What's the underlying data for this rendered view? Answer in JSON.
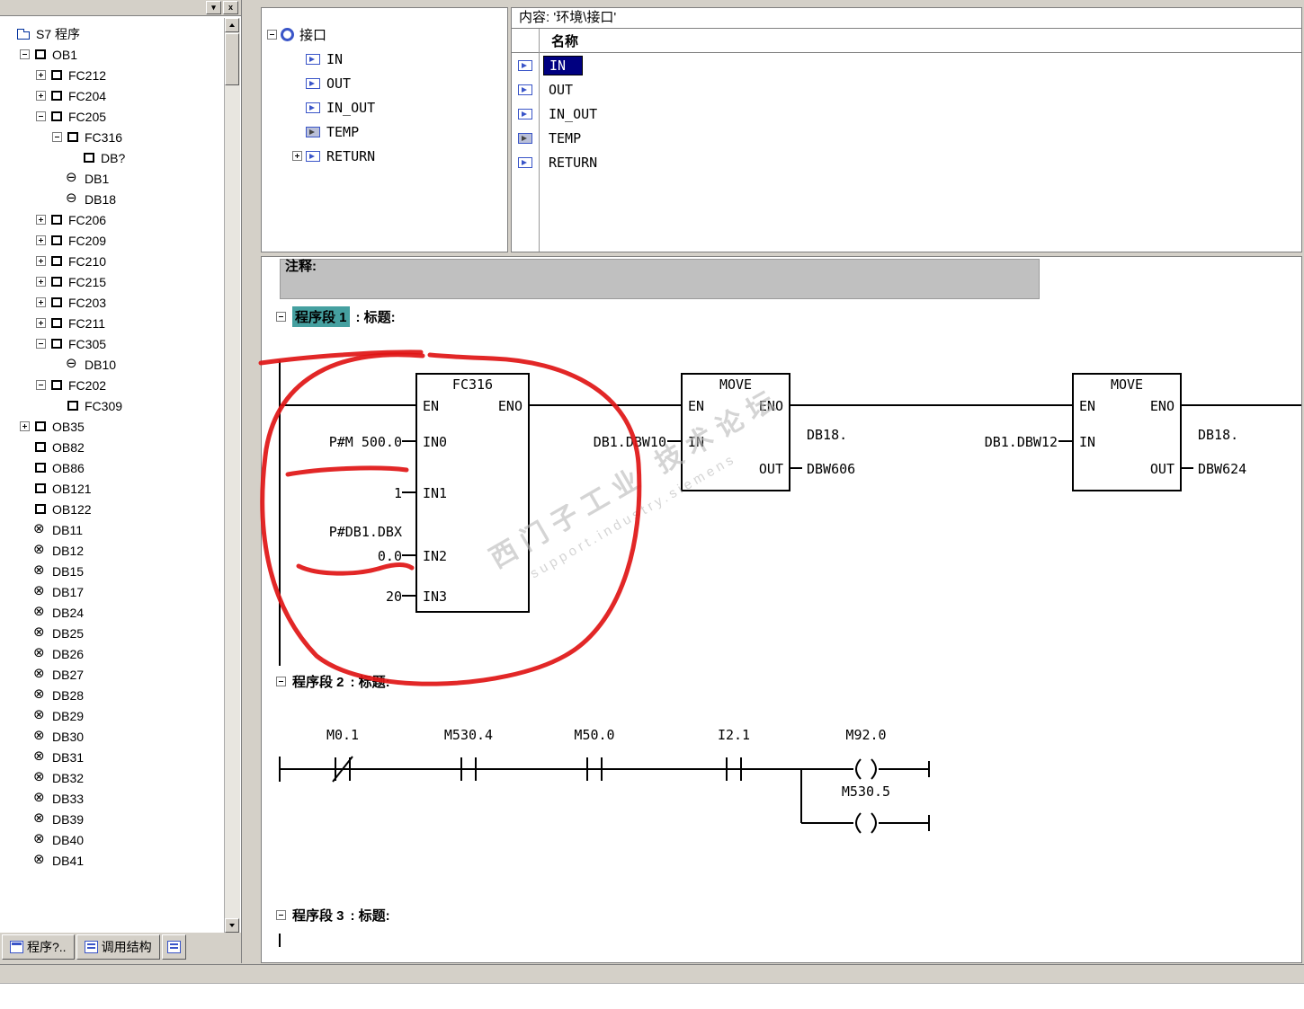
{
  "colors": {
    "chrome": "#d4d0c8",
    "border": "#808080",
    "commentGray": "#c0c0c0",
    "selectionNavy": "#000080",
    "networkTeal": "#45a0a0",
    "iconBlue": "#3a55c8",
    "watermarkGray": "#b9b9b9"
  },
  "left_panel": {
    "pin_glyph": "▾",
    "close_glyph": "x",
    "tabs": [
      {
        "label": "程序?.."
      },
      {
        "label": "调用结构"
      },
      {
        "label": ""
      }
    ],
    "tree": {
      "items": [
        {
          "label": "S7 程序",
          "levelClass": "lvl0",
          "expClass": "noexp",
          "iconClass": "icon-folder"
        },
        {
          "label": "OB1",
          "levelClass": "lvl1",
          "expClass": "minus",
          "iconClass": "icon-block"
        },
        {
          "label": "FC212",
          "levelClass": "lvl2",
          "expClass": "plus",
          "iconClass": "icon-block"
        },
        {
          "label": "FC204",
          "levelClass": "lvl2",
          "expClass": "plus",
          "iconClass": "icon-block"
        },
        {
          "label": "FC205",
          "levelClass": "lvl2",
          "expClass": "minus",
          "iconClass": "icon-block"
        },
        {
          "label": "FC316",
          "levelClass": "lvl3",
          "expClass": "minus",
          "iconClass": "icon-block"
        },
        {
          "label": "DB?",
          "levelClass": "lvl4",
          "expClass": "noexp",
          "iconClass": "icon-block"
        },
        {
          "label": "DB1",
          "levelClass": "lvl3",
          "expClass": "noexp",
          "iconClass": "icon-db"
        },
        {
          "label": "DB18",
          "levelClass": "lvl3",
          "expClass": "noexp",
          "iconClass": "icon-db"
        },
        {
          "label": "FC206",
          "levelClass": "lvl2",
          "expClass": "plus",
          "iconClass": "icon-block"
        },
        {
          "label": "FC209",
          "levelClass": "lvl2",
          "expClass": "plus",
          "iconClass": "icon-block"
        },
        {
          "label": "FC210",
          "levelClass": "lvl2",
          "expClass": "plus",
          "iconClass": "icon-block"
        },
        {
          "label": "FC215",
          "levelClass": "lvl2",
          "expClass": "plus",
          "iconClass": "icon-block"
        },
        {
          "label": "FC203",
          "levelClass": "lvl2",
          "expClass": "plus",
          "iconClass": "icon-block"
        },
        {
          "label": "FC211",
          "levelClass": "lvl2",
          "expClass": "plus",
          "iconClass": "icon-block"
        },
        {
          "label": "FC305",
          "levelClass": "lvl2",
          "expClass": "minus",
          "iconClass": "icon-block"
        },
        {
          "label": "DB10",
          "levelClass": "lvl3",
          "expClass": "noexp",
          "iconClass": "icon-db"
        },
        {
          "label": "FC202",
          "levelClass": "lvl2",
          "expClass": "minus",
          "iconClass": "icon-block"
        },
        {
          "label": "FC309",
          "levelClass": "lvl3",
          "expClass": "noexp",
          "iconClass": "icon-block"
        },
        {
          "label": "OB35",
          "levelClass": "lvl1",
          "expClass": "plus",
          "iconClass": "icon-block"
        },
        {
          "label": "OB82",
          "levelClass": "lvl1",
          "expClass": "noexp",
          "iconClass": "icon-block"
        },
        {
          "label": "OB86",
          "levelClass": "lvl1",
          "expClass": "noexp",
          "iconClass": "icon-block"
        },
        {
          "label": "OB121",
          "levelClass": "lvl1",
          "expClass": "noexp",
          "iconClass": "icon-block"
        },
        {
          "label": "OB122",
          "levelClass": "lvl1",
          "expClass": "noexp",
          "iconClass": "icon-block"
        },
        {
          "label": "DB11",
          "levelClass": "lvl1",
          "expClass": "noexp",
          "iconClass": "icon-dbx"
        },
        {
          "label": "DB12",
          "levelClass": "lvl1",
          "expClass": "noexp",
          "iconClass": "icon-dbx"
        },
        {
          "label": "DB15",
          "levelClass": "lvl1",
          "expClass": "noexp",
          "iconClass": "icon-dbx"
        },
        {
          "label": "DB17",
          "levelClass": "lvl1",
          "expClass": "noexp",
          "iconClass": "icon-dbx"
        },
        {
          "label": "DB24",
          "levelClass": "lvl1",
          "expClass": "noexp",
          "iconClass": "icon-dbx"
        },
        {
          "label": "DB25",
          "levelClass": "lvl1",
          "expClass": "noexp",
          "iconClass": "icon-dbx"
        },
        {
          "label": "DB26",
          "levelClass": "lvl1",
          "expClass": "noexp",
          "iconClass": "icon-dbx"
        },
        {
          "label": "DB27",
          "levelClass": "lvl1",
          "expClass": "noexp",
          "iconClass": "icon-dbx"
        },
        {
          "label": "DB28",
          "levelClass": "lvl1",
          "expClass": "noexp",
          "iconClass": "icon-dbx"
        },
        {
          "label": "DB29",
          "levelClass": "lvl1",
          "expClass": "noexp",
          "iconClass": "icon-dbx"
        },
        {
          "label": "DB30",
          "levelClass": "lvl1",
          "expClass": "noexp",
          "iconClass": "icon-dbx"
        },
        {
          "label": "DB31",
          "levelClass": "lvl1",
          "expClass": "noexp",
          "iconClass": "icon-dbx"
        },
        {
          "label": "DB32",
          "levelClass": "lvl1",
          "expClass": "noexp",
          "iconClass": "icon-dbx"
        },
        {
          "label": "DB33",
          "levelClass": "lvl1",
          "expClass": "noexp",
          "iconClass": "icon-dbx"
        },
        {
          "label": "DB39",
          "levelClass": "lvl1",
          "expClass": "noexp",
          "iconClass": "icon-dbx"
        },
        {
          "label": "DB40",
          "levelClass": "lvl1",
          "expClass": "noexp",
          "iconClass": "icon-dbx"
        },
        {
          "label": "DB41",
          "levelClass": "lvl1",
          "expClass": "noexp",
          "iconClass": "icon-dbx"
        }
      ]
    }
  },
  "interface_panel": {
    "root_label": "接口",
    "items": [
      {
        "label": "IN",
        "iconClass": "ic-in",
        "expClass": "noexp"
      },
      {
        "label": "OUT",
        "iconClass": "ic-out",
        "expClass": "noexp"
      },
      {
        "label": "IN_OUT",
        "iconClass": "ic-inout",
        "expClass": "noexp"
      },
      {
        "label": "TEMP",
        "iconClass": "ic-temp",
        "expClass": "noexp"
      },
      {
        "label": "RETURN",
        "iconClass": "ic-ret",
        "expClass": "plus"
      }
    ]
  },
  "content_panel": {
    "header": "内容:  '环境\\接口'",
    "name_column": "名称",
    "rows": [
      {
        "name": "IN",
        "iconClass": "ic-in",
        "selClass": "sel"
      },
      {
        "name": "OUT",
        "iconClass": "ic-out"
      },
      {
        "name": "IN_OUT",
        "iconClass": "ic-inout"
      },
      {
        "name": "TEMP",
        "iconClass": "ic-temp"
      },
      {
        "name": "RETURN",
        "iconClass": "ic-ret"
      }
    ]
  },
  "editor": {
    "comment_label": "注释:",
    "net1": {
      "label": "程序段 1",
      "suffix": ": 标题:"
    },
    "net2": {
      "label": "程序段 2",
      "suffix": ": 标题:"
    },
    "net3": {
      "label": "程序段 3",
      "suffix": ": 标题:"
    },
    "network1": {
      "fc": {
        "title": "FC316",
        "en": "EN",
        "eno": "ENO",
        "pin0": "IN0",
        "pin1": "IN1",
        "pin2": "IN2",
        "pin3": "IN3",
        "val0": "P#M 500.0",
        "val1": "1",
        "val2a": "P#DB1.DBX",
        "val2b": "0.0",
        "val3": "20"
      },
      "move1": {
        "title": "MOVE",
        "en": "EN",
        "eno": "ENO",
        "in": "IN",
        "out": "OUT",
        "in_value": "DB1.DBW10",
        "out_value_line1": "DB18.",
        "out_value_line2": "DBW606"
      },
      "move2": {
        "title": "MOVE",
        "en": "EN",
        "eno": "ENO",
        "in": "IN",
        "out": "OUT",
        "in_value": "DB1.DBW12",
        "out_value_line1": "DB18.",
        "out_value_line2": "DBW624"
      }
    },
    "network2": {
      "contact1": "M0.1",
      "contact2": "M530.4",
      "contact3": "M50.0",
      "contact4": "I2.1",
      "coil1": "M92.0",
      "coil2": "M530.5"
    }
  },
  "watermark": {
    "line1": "西门子工业 技术论坛",
    "line2": "support.industry.siemens"
  },
  "annotation": {
    "color": "#e01515"
  }
}
